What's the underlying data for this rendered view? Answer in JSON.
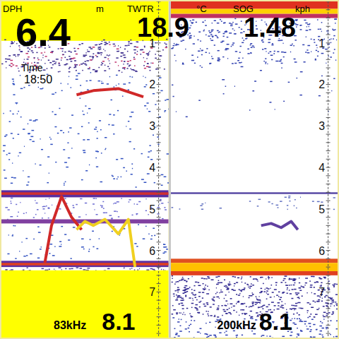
{
  "readouts": {
    "depth": {
      "label": "DPH",
      "unit": "m",
      "value": "6.4"
    },
    "time": {
      "label": "Time",
      "value": "18:50"
    },
    "water_temp": {
      "label": "TWTR",
      "unit": "°C",
      "value": "18.9"
    },
    "speed": {
      "label": "SOG",
      "unit": "kph",
      "value": "1.48"
    }
  },
  "panels": [
    {
      "frequency": "83kHz",
      "range": "8.1",
      "scale": [
        "1",
        "2",
        "3",
        "4",
        "5",
        "6",
        "7"
      ],
      "layers": [
        {
          "kind": "band",
          "from": 0,
          "to": 0.95,
          "color": "#ffff00"
        },
        {
          "kind": "noise",
          "from": 0.9,
          "to": 1.7,
          "color": "#3a2a8c",
          "density": 260
        },
        {
          "kind": "noise",
          "from": 1.0,
          "to": 1.6,
          "color": "#c0306a",
          "density": 60
        },
        {
          "kind": "noise",
          "from": 1.7,
          "to": 4.5,
          "color": "#3050c0",
          "density": 220
        },
        {
          "kind": "band",
          "from": 4.55,
          "to": 4.72,
          "color": "#5a2ea0"
        },
        {
          "kind": "band",
          "from": 4.6,
          "to": 4.66,
          "color": "#d03030"
        },
        {
          "kind": "noise",
          "from": 4.72,
          "to": 5.25,
          "color": "#6a6ad0",
          "density": 90
        },
        {
          "kind": "band",
          "from": 5.25,
          "to": 5.35,
          "color": "#8040a0"
        },
        {
          "kind": "noise",
          "from": 5.35,
          "to": 6.2,
          "color": "#3050c0",
          "density": 70
        },
        {
          "kind": "band",
          "from": 6.25,
          "to": 6.4,
          "color": "#6030a0"
        },
        {
          "kind": "band",
          "from": 6.3,
          "to": 6.36,
          "color": "#e04020"
        },
        {
          "kind": "noise",
          "from": 6.4,
          "to": 6.5,
          "color": "#4a3aa0",
          "density": 60
        },
        {
          "kind": "band",
          "from": 6.48,
          "to": 8.1,
          "color": "#ffff00"
        }
      ],
      "targets": [
        {
          "color": "#d02828",
          "points": [
            [
              0.45,
              2.25
            ],
            [
              0.55,
              2.15
            ],
            [
              0.7,
              2.1
            ],
            [
              0.85,
              2.3
            ]
          ]
        },
        {
          "color": "#d02828",
          "points": [
            [
              0.26,
              6.3
            ],
            [
              0.3,
              5.4
            ],
            [
              0.36,
              4.7
            ],
            [
              0.42,
              5.2
            ],
            [
              0.48,
              5.5
            ]
          ]
        },
        {
          "color": "#f0d020",
          "points": [
            [
              0.45,
              5.5
            ],
            [
              0.5,
              5.3
            ],
            [
              0.55,
              5.4
            ],
            [
              0.62,
              5.25
            ],
            [
              0.7,
              5.6
            ],
            [
              0.76,
              5.25
            ],
            [
              0.8,
              6.4
            ]
          ]
        }
      ]
    },
    {
      "frequency": "200kHz",
      "range": "8.1",
      "scale": [
        "1",
        "2",
        "3",
        "4",
        "5",
        "6",
        "7"
      ],
      "layers": [
        {
          "kind": "band",
          "from": 0,
          "to": 0.18,
          "color": "#e03020"
        },
        {
          "kind": "band",
          "from": 0.18,
          "to": 0.3,
          "color": "#ffd000"
        },
        {
          "kind": "band",
          "from": 0.3,
          "to": 0.4,
          "color": "#c03060"
        },
        {
          "kind": "noise",
          "from": 0.4,
          "to": 1.5,
          "color": "#3040b0",
          "density": 300
        },
        {
          "kind": "noise",
          "from": 1.5,
          "to": 2.8,
          "color": "#3040b0",
          "density": 30
        },
        {
          "kind": "band",
          "from": 4.6,
          "to": 4.64,
          "color": "#5040a0"
        },
        {
          "kind": "noise",
          "from": 4.64,
          "to": 5.0,
          "color": "#6070c0",
          "density": 30
        },
        {
          "kind": "band",
          "from": 6.2,
          "to": 6.3,
          "color": "#e05020"
        },
        {
          "kind": "band",
          "from": 6.3,
          "to": 6.5,
          "color": "#ffc000"
        },
        {
          "kind": "band",
          "from": 6.5,
          "to": 6.6,
          "color": "#e04020"
        },
        {
          "kind": "noise",
          "from": 6.6,
          "to": 7.6,
          "color": "#302890",
          "density": 500
        },
        {
          "kind": "noise",
          "from": 7.6,
          "to": 8.1,
          "color": "#3040b0",
          "density": 150
        }
      ],
      "targets": [
        {
          "color": "#6040a0",
          "points": [
            [
              0.54,
              5.4
            ],
            [
              0.6,
              5.35
            ],
            [
              0.66,
              5.45
            ],
            [
              0.72,
              5.3
            ],
            [
              0.76,
              5.5
            ]
          ]
        }
      ]
    }
  ]
}
